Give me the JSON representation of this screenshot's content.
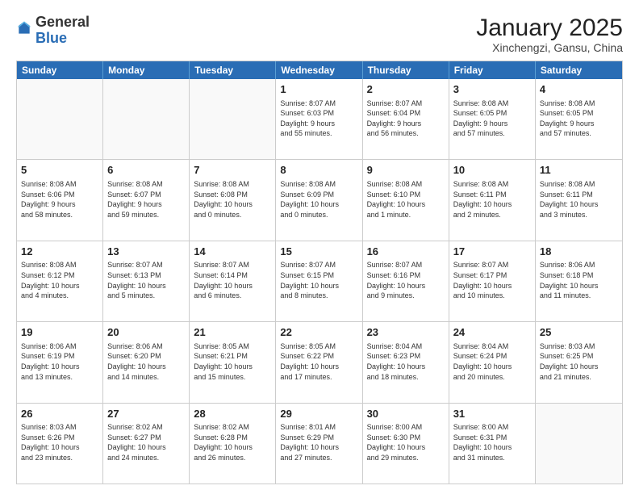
{
  "logo": {
    "general": "General",
    "blue": "Blue"
  },
  "title": "January 2025",
  "subtitle": "Xinchengzi, Gansu, China",
  "header_days": [
    "Sunday",
    "Monday",
    "Tuesday",
    "Wednesday",
    "Thursday",
    "Friday",
    "Saturday"
  ],
  "rows": [
    [
      {
        "day": "",
        "info": ""
      },
      {
        "day": "",
        "info": ""
      },
      {
        "day": "",
        "info": ""
      },
      {
        "day": "1",
        "info": "Sunrise: 8:07 AM\nSunset: 6:03 PM\nDaylight: 9 hours\nand 55 minutes."
      },
      {
        "day": "2",
        "info": "Sunrise: 8:07 AM\nSunset: 6:04 PM\nDaylight: 9 hours\nand 56 minutes."
      },
      {
        "day": "3",
        "info": "Sunrise: 8:08 AM\nSunset: 6:05 PM\nDaylight: 9 hours\nand 57 minutes."
      },
      {
        "day": "4",
        "info": "Sunrise: 8:08 AM\nSunset: 6:05 PM\nDaylight: 9 hours\nand 57 minutes."
      }
    ],
    [
      {
        "day": "5",
        "info": "Sunrise: 8:08 AM\nSunset: 6:06 PM\nDaylight: 9 hours\nand 58 minutes."
      },
      {
        "day": "6",
        "info": "Sunrise: 8:08 AM\nSunset: 6:07 PM\nDaylight: 9 hours\nand 59 minutes."
      },
      {
        "day": "7",
        "info": "Sunrise: 8:08 AM\nSunset: 6:08 PM\nDaylight: 10 hours\nand 0 minutes."
      },
      {
        "day": "8",
        "info": "Sunrise: 8:08 AM\nSunset: 6:09 PM\nDaylight: 10 hours\nand 0 minutes."
      },
      {
        "day": "9",
        "info": "Sunrise: 8:08 AM\nSunset: 6:10 PM\nDaylight: 10 hours\nand 1 minute."
      },
      {
        "day": "10",
        "info": "Sunrise: 8:08 AM\nSunset: 6:11 PM\nDaylight: 10 hours\nand 2 minutes."
      },
      {
        "day": "11",
        "info": "Sunrise: 8:08 AM\nSunset: 6:11 PM\nDaylight: 10 hours\nand 3 minutes."
      }
    ],
    [
      {
        "day": "12",
        "info": "Sunrise: 8:08 AM\nSunset: 6:12 PM\nDaylight: 10 hours\nand 4 minutes."
      },
      {
        "day": "13",
        "info": "Sunrise: 8:07 AM\nSunset: 6:13 PM\nDaylight: 10 hours\nand 5 minutes."
      },
      {
        "day": "14",
        "info": "Sunrise: 8:07 AM\nSunset: 6:14 PM\nDaylight: 10 hours\nand 6 minutes."
      },
      {
        "day": "15",
        "info": "Sunrise: 8:07 AM\nSunset: 6:15 PM\nDaylight: 10 hours\nand 8 minutes."
      },
      {
        "day": "16",
        "info": "Sunrise: 8:07 AM\nSunset: 6:16 PM\nDaylight: 10 hours\nand 9 minutes."
      },
      {
        "day": "17",
        "info": "Sunrise: 8:07 AM\nSunset: 6:17 PM\nDaylight: 10 hours\nand 10 minutes."
      },
      {
        "day": "18",
        "info": "Sunrise: 8:06 AM\nSunset: 6:18 PM\nDaylight: 10 hours\nand 11 minutes."
      }
    ],
    [
      {
        "day": "19",
        "info": "Sunrise: 8:06 AM\nSunset: 6:19 PM\nDaylight: 10 hours\nand 13 minutes."
      },
      {
        "day": "20",
        "info": "Sunrise: 8:06 AM\nSunset: 6:20 PM\nDaylight: 10 hours\nand 14 minutes."
      },
      {
        "day": "21",
        "info": "Sunrise: 8:05 AM\nSunset: 6:21 PM\nDaylight: 10 hours\nand 15 minutes."
      },
      {
        "day": "22",
        "info": "Sunrise: 8:05 AM\nSunset: 6:22 PM\nDaylight: 10 hours\nand 17 minutes."
      },
      {
        "day": "23",
        "info": "Sunrise: 8:04 AM\nSunset: 6:23 PM\nDaylight: 10 hours\nand 18 minutes."
      },
      {
        "day": "24",
        "info": "Sunrise: 8:04 AM\nSunset: 6:24 PM\nDaylight: 10 hours\nand 20 minutes."
      },
      {
        "day": "25",
        "info": "Sunrise: 8:03 AM\nSunset: 6:25 PM\nDaylight: 10 hours\nand 21 minutes."
      }
    ],
    [
      {
        "day": "26",
        "info": "Sunrise: 8:03 AM\nSunset: 6:26 PM\nDaylight: 10 hours\nand 23 minutes."
      },
      {
        "day": "27",
        "info": "Sunrise: 8:02 AM\nSunset: 6:27 PM\nDaylight: 10 hours\nand 24 minutes."
      },
      {
        "day": "28",
        "info": "Sunrise: 8:02 AM\nSunset: 6:28 PM\nDaylight: 10 hours\nand 26 minutes."
      },
      {
        "day": "29",
        "info": "Sunrise: 8:01 AM\nSunset: 6:29 PM\nDaylight: 10 hours\nand 27 minutes."
      },
      {
        "day": "30",
        "info": "Sunrise: 8:00 AM\nSunset: 6:30 PM\nDaylight: 10 hours\nand 29 minutes."
      },
      {
        "day": "31",
        "info": "Sunrise: 8:00 AM\nSunset: 6:31 PM\nDaylight: 10 hours\nand 31 minutes."
      },
      {
        "day": "",
        "info": ""
      }
    ]
  ]
}
